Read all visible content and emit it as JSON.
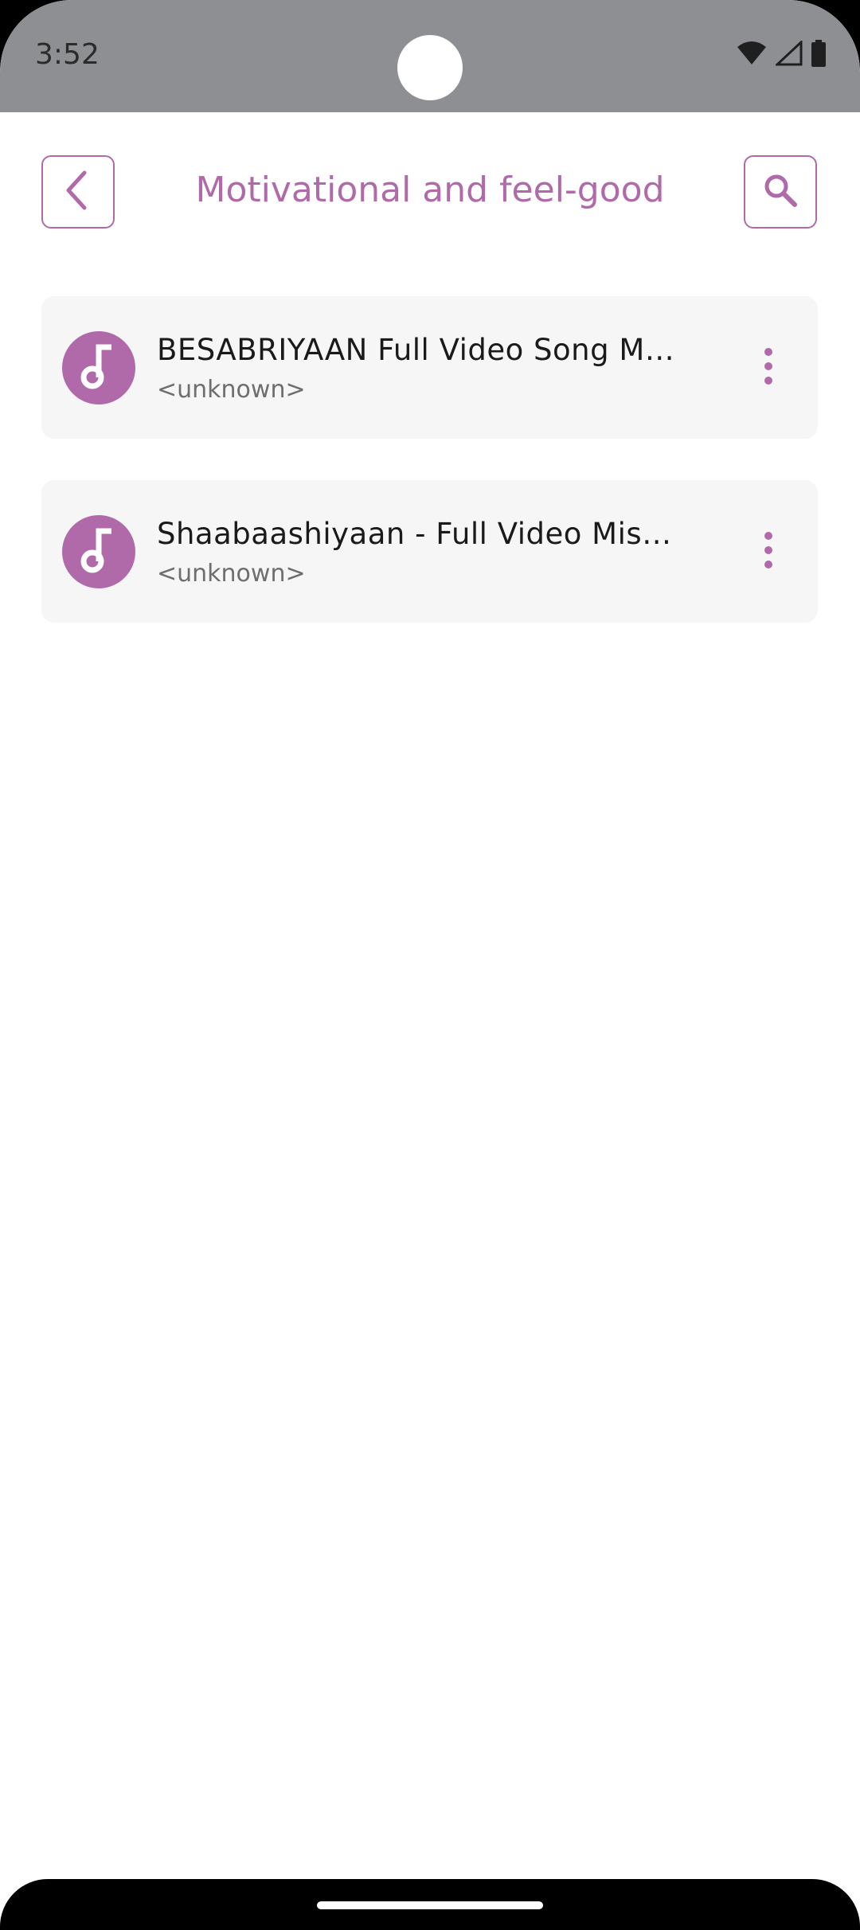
{
  "status_bar": {
    "time": "3:52",
    "icons": [
      "wifi-icon",
      "cellular-signal-icon",
      "battery-icon"
    ]
  },
  "header": {
    "title": "Motivational and feel-good",
    "back_icon": "chevron-left-icon",
    "search_icon": "search-icon"
  },
  "songs": [
    {
      "title": "BESABRIYAAN Full Video Song  M…",
      "subtitle": "<unknown>",
      "icon": "music-note-icon"
    },
    {
      "title": "Shaabaashiyaan - Full Video  Mis…",
      "subtitle": "<unknown>",
      "icon": "music-note-icon"
    }
  ],
  "colors": {
    "accent": "#b06aaa",
    "status_bar": "#8e8f92",
    "card_background": "#f6f6f6"
  }
}
